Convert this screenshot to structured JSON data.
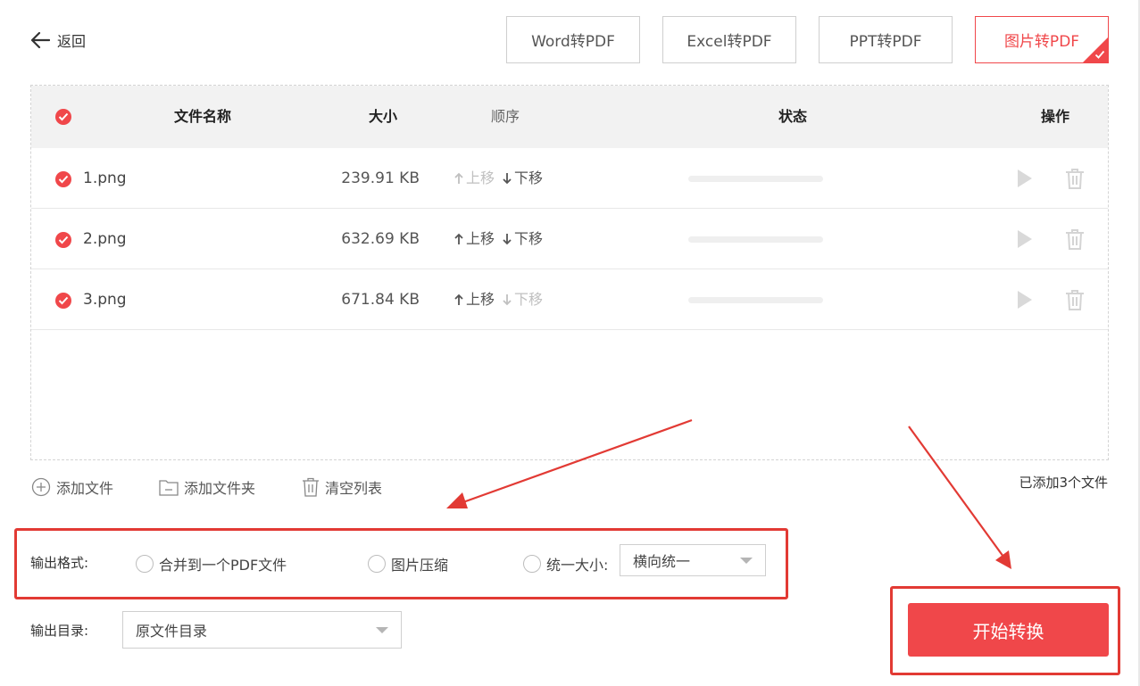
{
  "header": {
    "back_label": "返回",
    "tabs": [
      {
        "label": "Word转PDF",
        "active": false
      },
      {
        "label": "Excel转PDF",
        "active": false
      },
      {
        "label": "PPT转PDF",
        "active": false
      },
      {
        "label": "图片转PDF",
        "active": true
      }
    ]
  },
  "table": {
    "columns": {
      "name": "文件名称",
      "size": "大小",
      "order": "顺序",
      "status": "状态",
      "actions": "操作"
    },
    "rows": [
      {
        "name": "1.png",
        "size": "239.91 KB",
        "move_up": "上移",
        "move_down": "下移",
        "up_enabled": false,
        "down_enabled": true,
        "progress": 0
      },
      {
        "name": "2.png",
        "size": "632.69 KB",
        "move_up": "上移",
        "move_down": "下移",
        "up_enabled": true,
        "down_enabled": true,
        "progress": 0
      },
      {
        "name": "3.png",
        "size": "671.84 KB",
        "move_up": "上移",
        "move_down": "下移",
        "up_enabled": true,
        "down_enabled": false,
        "progress": 0
      }
    ]
  },
  "footer_actions": {
    "add_file": "添加文件",
    "add_folder": "添加文件夹",
    "clear_list": "清空列表",
    "added_count": "已添加3个文件"
  },
  "output_format": {
    "label": "输出格式:",
    "options": [
      "合并到一个PDF文件",
      "图片压缩",
      "统一大小:"
    ],
    "size_select_value": "横向统一"
  },
  "output_dir": {
    "label": "输出目录:",
    "value": "原文件目录"
  },
  "start_button": "开始转换",
  "colors": {
    "accent": "#f0474a",
    "highlight_border": "#e23a34",
    "header_bg": "#f2f2f2"
  },
  "icons": [
    "back-arrow-icon",
    "check-circle-icon",
    "arrow-up-icon",
    "arrow-down-icon",
    "play-icon",
    "trash-icon",
    "plus-circle-icon",
    "folder-icon",
    "clear-trash-icon",
    "dropdown-caret-icon",
    "corner-check-icon"
  ]
}
